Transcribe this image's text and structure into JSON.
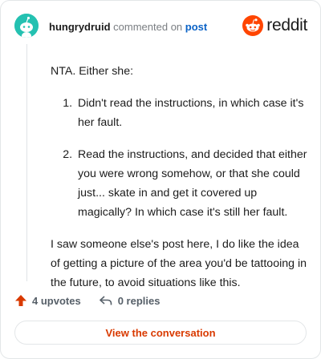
{
  "header": {
    "username": "hungrydruid",
    "action_text": "commented on",
    "target_link": "post"
  },
  "brand": {
    "name": "reddit",
    "icon": "reddit-snoo-icon",
    "color": "#ff4500"
  },
  "comment": {
    "intro": "NTA. Either she:",
    "list_items": [
      "Didn't read the instructions, in which case it's her fault.",
      "Read the instructions, and decided that either you were wrong somehow, or that she could just... skate in and get it covered up magically? In which case it's still her fault."
    ],
    "closing": "I saw someone else's post here, I do like the idea of getting a picture of the area you'd be tattooing in the future, to avoid situations like this."
  },
  "stats": {
    "upvotes_label": "4 upvotes",
    "replies_label": "0 replies",
    "upvote_icon": "upvote-arrow-icon",
    "reply_icon": "reply-arrow-icon"
  },
  "cta": {
    "label": "View the conversation"
  },
  "colors": {
    "accent": "#d93a00",
    "link": "#0a62c6",
    "avatar_bg": "#24c1b1"
  }
}
